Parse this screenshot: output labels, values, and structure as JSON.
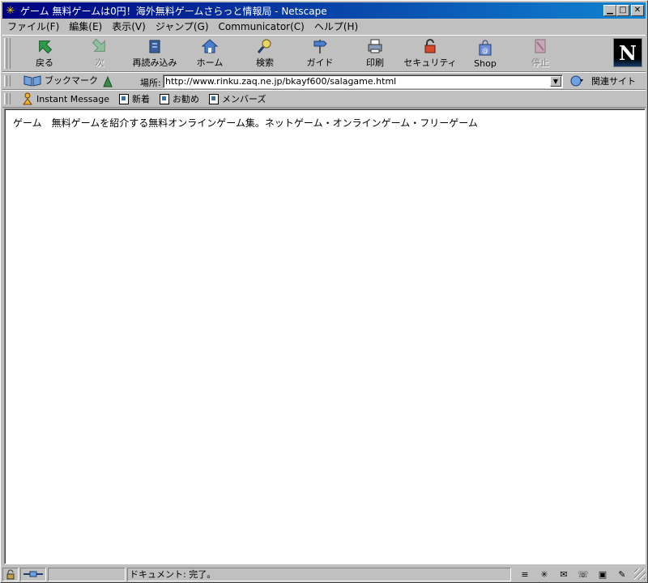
{
  "window": {
    "title": "ゲーム 無料ゲームは0円！海外無料ゲームさらっと情報局 - Netscape"
  },
  "menu": {
    "file": "ファイル(F)",
    "edit": "編集(E)",
    "view": "表示(V)",
    "jump": "ジャンプ(G)",
    "communicator": "Communicator(C)",
    "help": "ヘルプ(H)"
  },
  "nav": {
    "back": "戻る",
    "forward": "次",
    "reload": "再読み込み",
    "home": "ホーム",
    "search": "検索",
    "guide": "ガイド",
    "print": "印刷",
    "security": "セキュリティ",
    "shop": "Shop",
    "stop": "停止"
  },
  "location": {
    "bookmarks_label": "ブックマーク",
    "label": "場所:",
    "url": "http://www.rinku.zaq.ne.jp/bkayf600/salagame.html",
    "related_label": "関連サイト"
  },
  "personal_toolbar": {
    "instant_message": "Instant Message",
    "new": "新着",
    "recommend": "お勧め",
    "members": "メンバーズ"
  },
  "page": {
    "text": "ゲーム　無料ゲームを紹介する無料オンラインゲーム集。ネットゲーム・オンラインゲーム・フリーゲーム"
  },
  "status": {
    "text": "ドキュメント: 完了。"
  },
  "colors": {
    "titlebar_start": "#000080",
    "titlebar_end": "#1084d0",
    "chrome": "#c0c0c0"
  }
}
